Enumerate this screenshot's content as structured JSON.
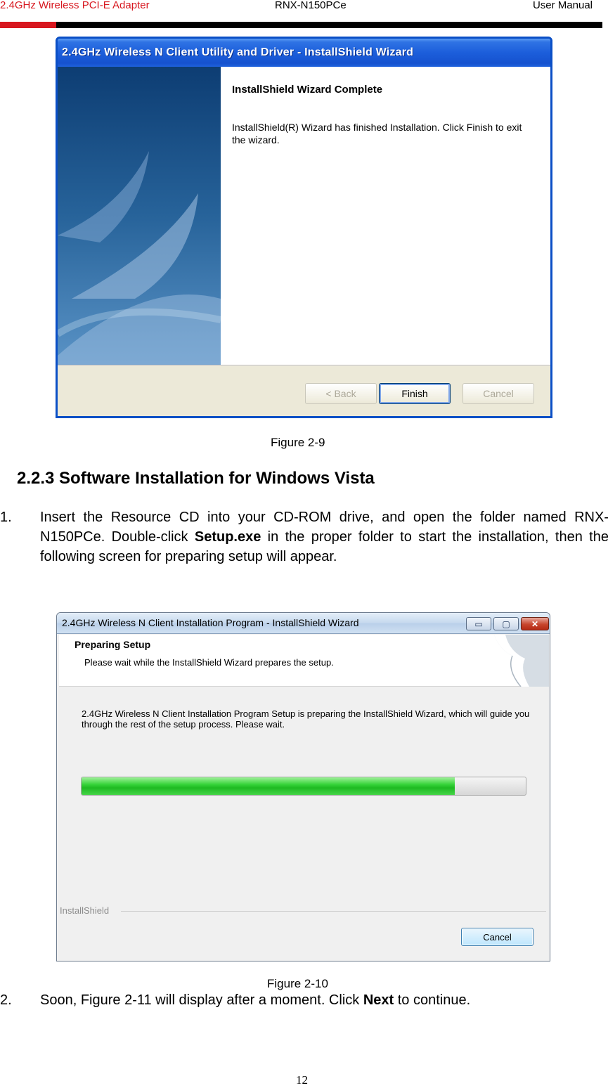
{
  "header": {
    "left": "2.4GHz Wireless PCI-E Adapter",
    "center": "RNX-N150PCe",
    "right": "User Manual"
  },
  "figure_2_9": {
    "window_title": "2.4GHz Wireless N Client Utility and Driver - InstallShield Wizard",
    "heading": "InstallShield Wizard Complete",
    "message": "InstallShield(R) Wizard has finished Installation. Click Finish to exit the wizard.",
    "buttons": {
      "back": "< Back",
      "finish": "Finish",
      "cancel": "Cancel"
    },
    "caption": "Figure 2-9"
  },
  "section": {
    "title": "2.2.3 Software Installation for Windows Vista"
  },
  "steps": [
    {
      "number": "1.",
      "text_before": "Insert the Resource CD into your CD-ROM drive, and open the folder named RNX-N150PCe. Double-click ",
      "bold": "Setup.exe",
      "text_after": " in the proper folder to start the installation, then the following screen for preparing setup will appear."
    },
    {
      "number": "2.",
      "text_before": "Soon, Figure 2-11 will display after a moment. Click ",
      "bold": "Next",
      "text_after": " to continue."
    }
  ],
  "figure_2_10": {
    "window_title": "2.4GHz Wireless N Client Installation Program - InstallShield Wizard",
    "window_controls": {
      "minimize": "▭",
      "maximize": "▢",
      "close": "✕"
    },
    "header_title": "Preparing Setup",
    "header_subtitle": "Please wait while the InstallShield Wizard prepares the setup.",
    "description": "2.4GHz Wireless N Client Installation Program Setup is preparing the InstallShield Wizard, which will guide you through the rest of the setup process. Please wait.",
    "progress_percent": 84,
    "brand": "InstallShield",
    "cancel_label": "Cancel",
    "caption": "Figure 2-10"
  },
  "page_number": "12",
  "colors": {
    "brand_red": "#d7171f",
    "xp_title_blue": "#1c5edb",
    "progress_green": "#1fba22"
  }
}
